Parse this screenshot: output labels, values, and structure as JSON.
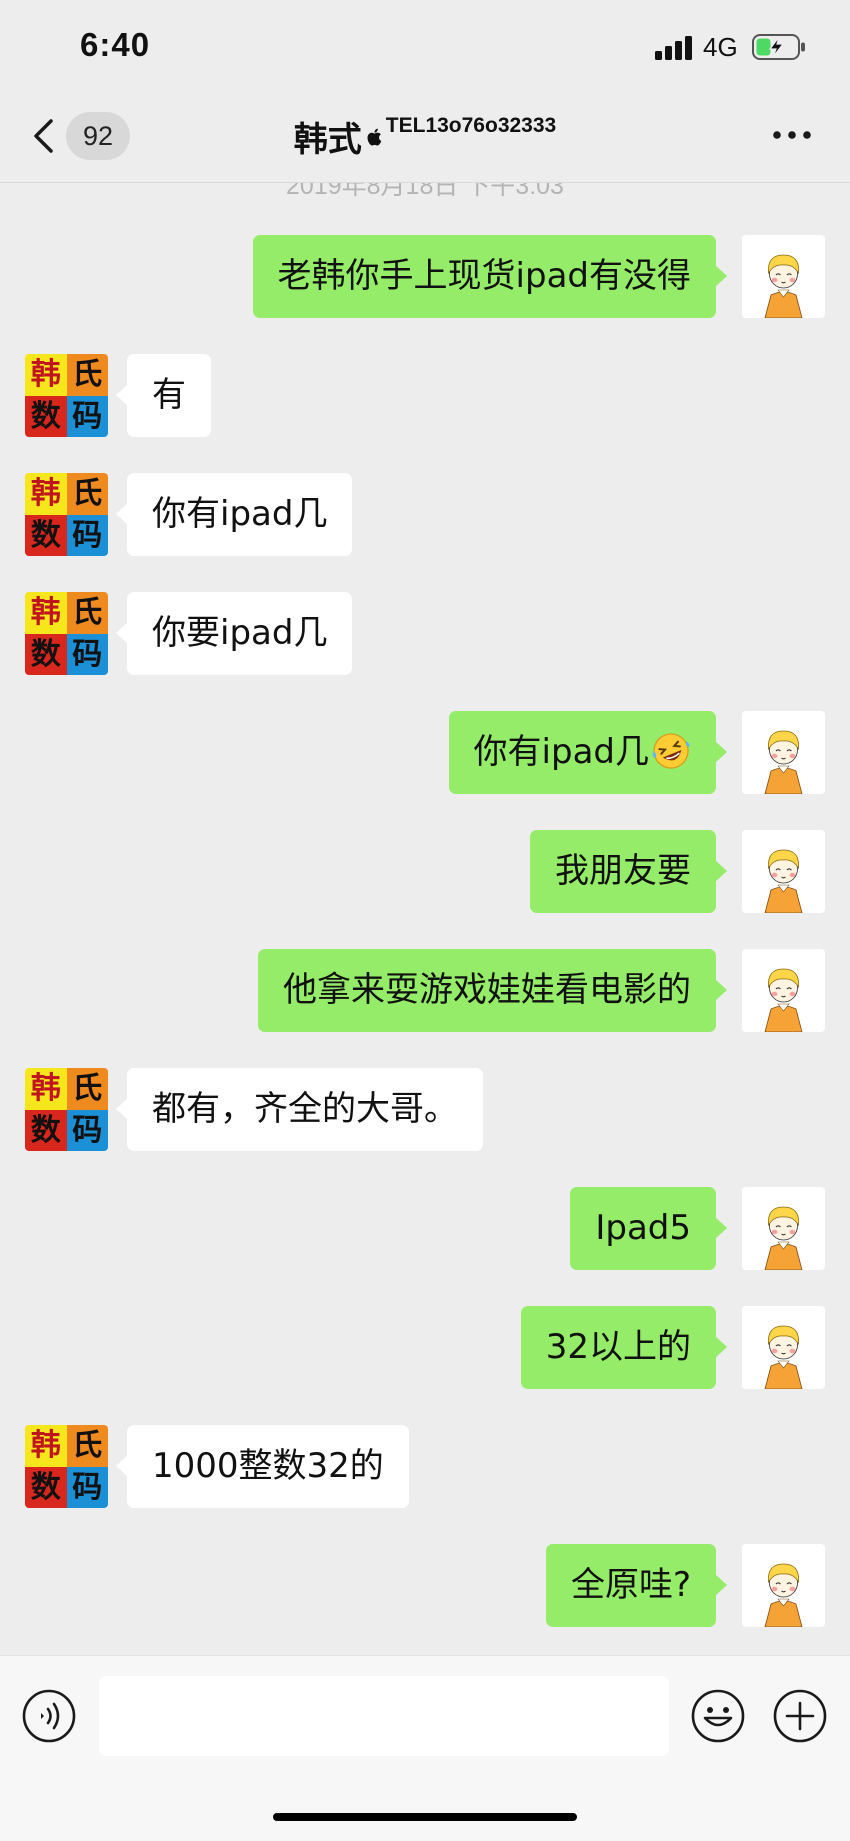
{
  "status_bar": {
    "time": "6:40",
    "network": "4G",
    "signal_icon": "signal-bars-icon",
    "battery_icon": "battery-charging-icon"
  },
  "header": {
    "back_icon": "chevron-left-icon",
    "unread_count": "92",
    "title": "韩式",
    "title_icon": "apple-icon",
    "subtitle": "TEL13o76o32333",
    "more_icon": "more-dots-icon"
  },
  "timestamp": "2019年8月18日 下午3:03",
  "contact_avatar": {
    "chars": [
      "韩",
      "氏",
      "数",
      "码"
    ],
    "colors": [
      "#f6e71d",
      "#ef8a1f",
      "#d8271d",
      "#1b90d6"
    ]
  },
  "my_avatar": {
    "icon": "cartoon-child-avatar-icon"
  },
  "messages": [
    {
      "text": "老韩你手上现货ipad有没得"
    },
    {
      "text": "有"
    },
    {
      "text": "你有ipad几"
    },
    {
      "text": "你要ipad几"
    },
    {
      "text": "你有ipad几",
      "emoji": "laughing-tears-emoji-icon"
    },
    {
      "text": "我朋友要"
    },
    {
      "text": "他拿来耍游戏娃娃看电影的"
    },
    {
      "text": "都有，齐全的大哥。"
    },
    {
      "text": "Ipad5"
    },
    {
      "text": "32以上的"
    },
    {
      "text": "1000整数32的"
    },
    {
      "text": "全原哇?"
    }
  ],
  "input_bar": {
    "voice_icon": "voice-icon",
    "input_value": "",
    "emoji_icon": "emoji-face-icon",
    "plus_icon": "plus-circle-icon"
  },
  "colors": {
    "background": "#ededed",
    "sent_bubble": "#95ec69",
    "received_bubble": "#ffffff",
    "battery_charge": "#4cd964"
  }
}
